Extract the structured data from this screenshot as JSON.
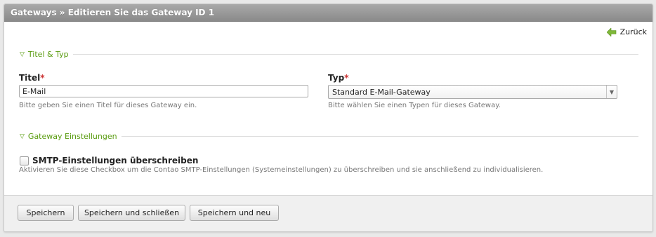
{
  "header": {
    "title": "Gateways » Editieren Sie das Gateway ID 1"
  },
  "back_link": {
    "label": "Zurück",
    "icon": "arrow-left-icon"
  },
  "fieldsets": [
    {
      "legend": "Titel & Typ"
    },
    {
      "legend": "Gateway Einstellungen"
    }
  ],
  "title_field": {
    "label": "Titel",
    "required_mark": "*",
    "value": "E-Mail",
    "tip": "Bitte geben Sie einen Titel für dieses Gateway ein."
  },
  "type_field": {
    "label": "Typ",
    "required_mark": "*",
    "selected": "Standard E-Mail-Gateway",
    "tip": "Bitte wählen Sie einen Typen für dieses Gateway."
  },
  "smtp": {
    "label": "SMTP-Einstellungen überschreiben",
    "checked": false,
    "tip": "Aktivieren Sie diese Checkbox um die Contao SMTP-Einstellungen (Systemeinstellungen) zu überschreiben und sie anschließend zu individualisieren."
  },
  "footer": {
    "save": "Speichern",
    "save_close": "Speichern und schließen",
    "save_new": "Speichern und neu"
  },
  "colors": {
    "accent": "#589b0e",
    "required": "#cc3333",
    "header": "#999999"
  }
}
